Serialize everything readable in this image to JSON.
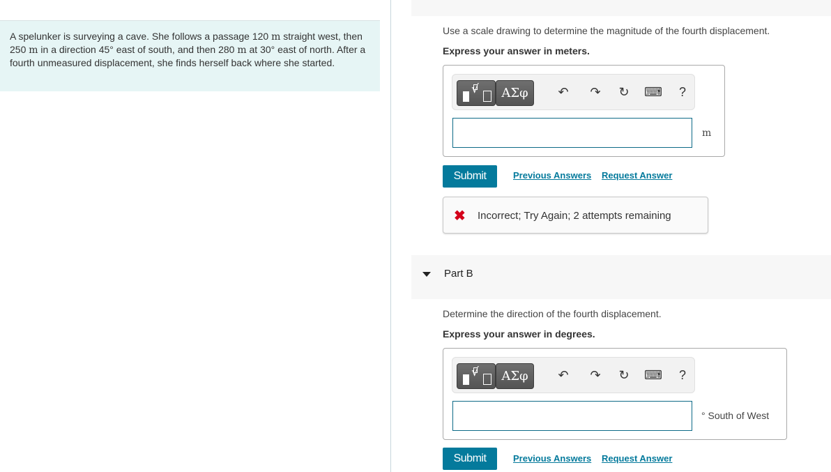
{
  "problem": {
    "segments": [
      {
        "t": "A spelunker is surveying a cave. She follows a passage 120 "
      },
      {
        "t": "m",
        "serif": true
      },
      {
        "t": " straight west, then 250 "
      },
      {
        "t": "m",
        "serif": true
      },
      {
        "t": " in a direction 45° east of south, and then 280 "
      },
      {
        "t": "m",
        "serif": true
      },
      {
        "t": " at 30° east of north. After a fourth unmeasured displacement, she finds herself back where she started."
      }
    ]
  },
  "partA": {
    "prompt": "Use a scale drawing to determine the magnitude of the fourth displacement.",
    "instruction": "Express your answer in meters.",
    "toolbar": {
      "templates_label": "templates",
      "greek_label": "ΑΣφ",
      "undo_glyph": "↶",
      "redo_glyph": "↷",
      "reset_glyph": "↻",
      "keyboard_glyph": "⌨",
      "help_label": "?"
    },
    "input_value": "",
    "unit": "m",
    "submit_label": "Submit",
    "previous_answers_label": "Previous Answers",
    "request_answer_label": "Request Answer",
    "feedback": {
      "icon": "✖",
      "message": "Incorrect; Try Again; 2 attempts remaining",
      "icon_color": "#d4001a"
    }
  },
  "partB": {
    "title": "Part B",
    "prompt": "Determine the direction of the fourth displacement.",
    "instruction": "Express your answer in degrees.",
    "toolbar": {
      "greek_label": "ΑΣφ",
      "undo_glyph": "↶",
      "redo_glyph": "↷",
      "reset_glyph": "↻",
      "keyboard_glyph": "⌨",
      "help_label": "?"
    },
    "input_value": "",
    "unit": "° South of West",
    "submit_label": "Submit",
    "previous_answers_label": "Previous Answers",
    "request_answer_label": "Request Answer"
  },
  "colors": {
    "accent": "#047a9c",
    "problem_bg": "#e6f5f5",
    "error": "#d4001a"
  }
}
